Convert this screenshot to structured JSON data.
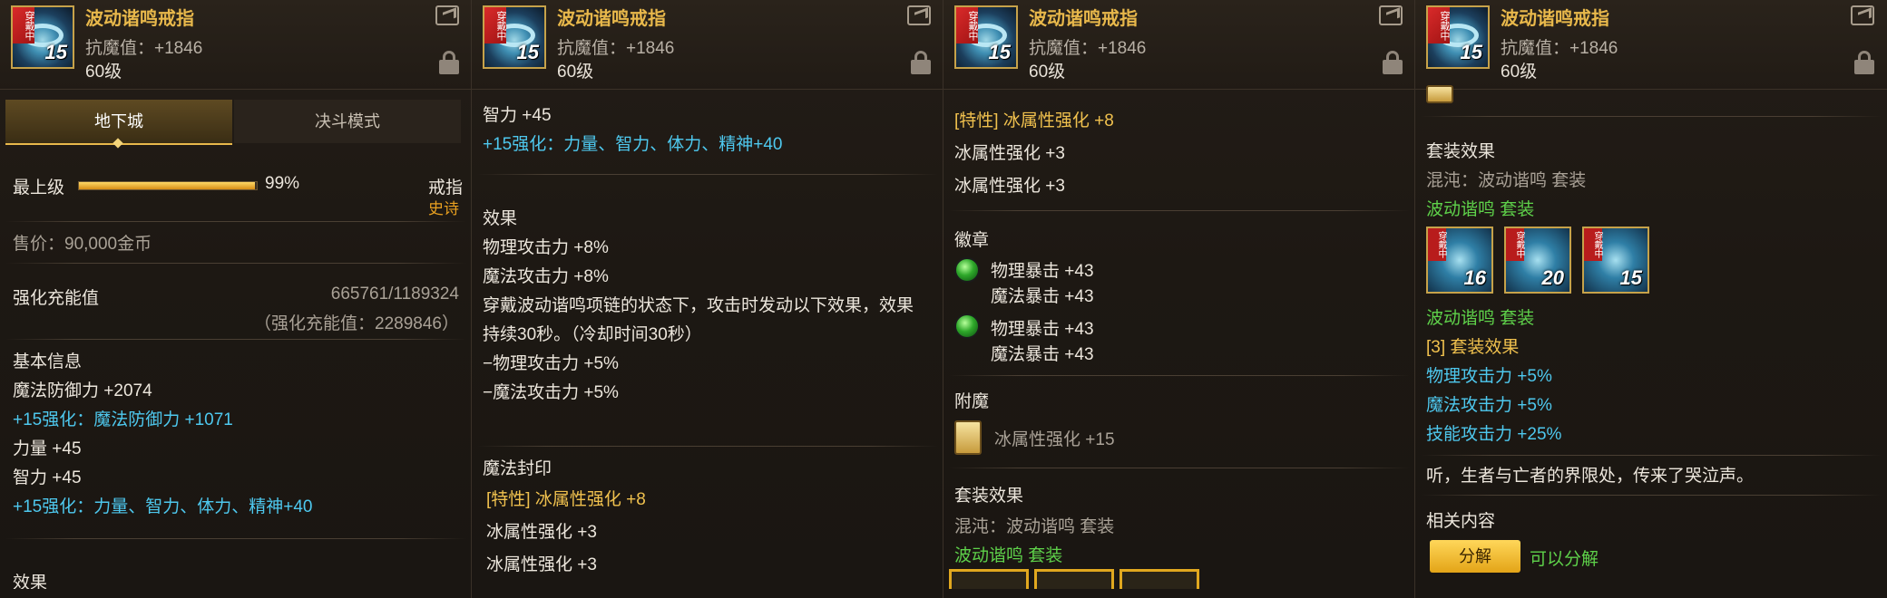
{
  "item": {
    "name": "波动谐鸣戒指",
    "resistance": "抗魔值：+1846",
    "level": "60级",
    "enhance_level": "15",
    "equipped_tag": "穿戴中"
  },
  "p1": {
    "tabs": [
      "地下城",
      "决斗模式"
    ],
    "grade_label": "最上级",
    "grade_percent": "99%",
    "grade_fill": 0.99,
    "type": "戒指",
    "rarity": "史诗",
    "price": "售价：90,000金币",
    "charge_label": "强化充能值",
    "charge_value": "665761/1189324",
    "charge_sub": "（强化充能值：2289846）",
    "basic_title": "基本信息",
    "lines": [
      "魔法防御力 +2074",
      "+15强化：魔法防御力 +1071",
      "力量 +45",
      "智力 +45",
      "+15强化：力量、智力、体力、精神+40"
    ],
    "cut_title": "效果"
  },
  "p2": {
    "line1": "智力 +45",
    "line2": "+15强化：力量、智力、体力、精神+40",
    "effect_title": "效果",
    "effects": [
      "物理攻击力 +8%",
      "魔法攻击力 +8%",
      "穿戴波动谐鸣项链的状态下，攻击时发动以下效果，效果",
      "持续30秒。（冷却时间30秒）",
      "−物理攻击力 +5%",
      "−魔法攻击力 +5%"
    ],
    "seal_title": "魔法封印",
    "seal_lines": [
      "[特性] 冰属性强化 +8",
      "冰属性强化 +3",
      "冰属性强化 +3"
    ]
  },
  "p3": {
    "seal_lines": [
      "[特性] 冰属性强化 +8",
      "冰属性强化 +3",
      "冰属性强化 +3"
    ],
    "emblem_title": "徽章",
    "emblems": [
      [
        "物理暴击 +43",
        "魔法暴击 +43"
      ],
      [
        "物理暴击 +43",
        "魔法暴击 +43"
      ]
    ],
    "enchant_title": "附魔",
    "enchant": "冰属性强化 +15",
    "set_title": "套装效果",
    "set_line1": "混沌：波动谐鸣 套装",
    "set_line2": "波动谐鸣 套装"
  },
  "p4": {
    "set_title": "套装效果",
    "set_line1": "混沌：波动谐鸣 套装",
    "set_line2": "波动谐鸣 套装",
    "set_icons": [
      "16",
      "20",
      "15"
    ],
    "set_line3": "波动谐鸣 套装",
    "bonus_title": "[3] 套装效果",
    "bonuses": [
      "物理攻击力 +5%",
      "魔法攻击力 +5%",
      "技能攻击力 +25%"
    ],
    "flavor": "听，生者与亡者的界限处，传来了哭泣声。",
    "related_title": "相关内容",
    "disassemble_btn": "分解",
    "disassemble_note": "可以分解"
  }
}
